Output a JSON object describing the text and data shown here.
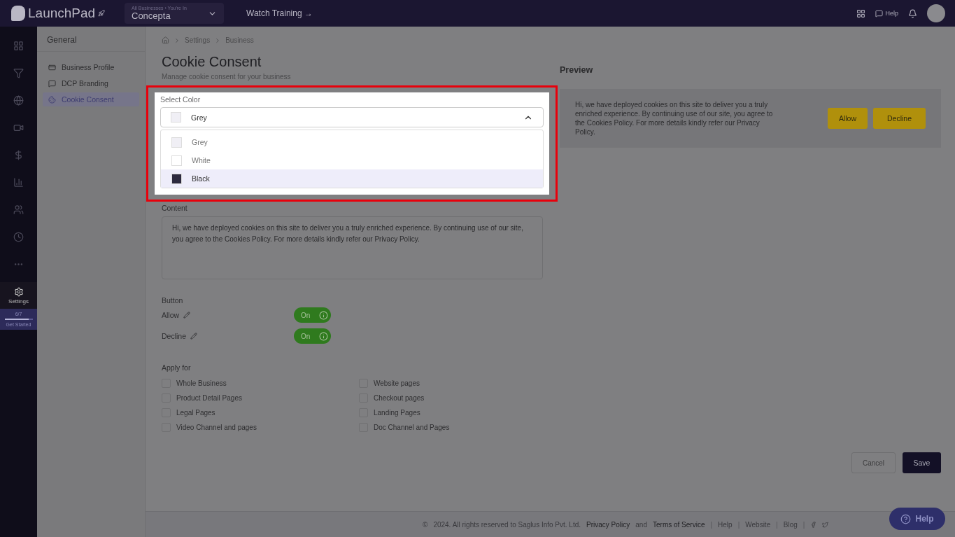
{
  "topbar": {
    "logo": "LaunchPad",
    "business_caption": "All Businesses › You're In",
    "business": "Concepta",
    "training_link": "Watch Training →",
    "help": "Help"
  },
  "rail": {
    "items": [
      {
        "kind": "dashboard",
        "selected": false
      },
      {
        "kind": "filter",
        "selected": false
      },
      {
        "kind": "globe",
        "selected": false
      },
      {
        "kind": "video",
        "selected": false
      },
      {
        "kind": "dollar",
        "selected": false
      },
      {
        "kind": "chart",
        "selected": false
      },
      {
        "kind": "users",
        "selected": false
      },
      {
        "kind": "clock",
        "selected": false
      },
      {
        "kind": "more",
        "selected": false
      }
    ],
    "settings": {
      "label": "Settings",
      "selected": true
    },
    "progress": {
      "count": "6/7",
      "level": 0.85,
      "label": "Get Started"
    }
  },
  "sidebar": {
    "heading": "General",
    "items": [
      {
        "label": "Business Profile",
        "selected": false
      },
      {
        "label": "DCP Branding",
        "selected": false
      },
      {
        "label": "Cookie Consent",
        "selected": true
      }
    ]
  },
  "breadcrumb": [
    "Settings",
    "Business"
  ],
  "page": {
    "title": "Cookie Consent",
    "subtitle": "Manage cookie consent for your business"
  },
  "color_picker": {
    "label": "Select Color",
    "value": {
      "label": "Grey",
      "color": "#f0eff5"
    },
    "expanded": true,
    "options": [
      {
        "label": "Grey",
        "color": "#f0eff5",
        "hovered": false
      },
      {
        "label": "White",
        "color": "#ffffff",
        "hovered": false
      },
      {
        "label": "Black",
        "color": "#2d2a3e",
        "hovered": true
      }
    ]
  },
  "content": {
    "label": "Content",
    "text": "Hi, we have deployed cookies on this site to deliver you a truly enriched experience. By continuing use of our site, you agree to the Cookies Policy. For more details kindly refer our Privacy Policy."
  },
  "buttons_section": {
    "heading": "Button",
    "items": [
      {
        "label": "Allow",
        "toggle": "On",
        "on": true
      },
      {
        "label": "Decline",
        "toggle": "On",
        "on": true
      }
    ]
  },
  "apply_for": {
    "heading": "Apply for",
    "options": [
      {
        "label": "Whole Business",
        "checked": false
      },
      {
        "label": "Website pages",
        "checked": false
      },
      {
        "label": "Product Detail Pages",
        "checked": false
      },
      {
        "label": "Checkout pages",
        "checked": false
      },
      {
        "label": "Legal Pages",
        "checked": false
      },
      {
        "label": "Landing Pages",
        "checked": false
      },
      {
        "label": "Video Channel and pages",
        "checked": false
      },
      {
        "label": "Doc Channel and Pages",
        "checked": false
      }
    ]
  },
  "preview": {
    "heading": "Preview",
    "text": "Hi, we have deployed cookies on this site to deliver you a truly enriched experience. By continuing use of our site, you agree to the Cookies Policy. For more details kindly refer our Privacy Policy.",
    "allow": "Allow",
    "decline": "Decline"
  },
  "actions": {
    "cancel": "Cancel",
    "save": "Save"
  },
  "footer": {
    "copyright_mark": "©",
    "separator": "|",
    "copyright": "2024. All rights reserved to Saglus Info Pvt. Ltd.",
    "privacy": "Privacy Policy",
    "and": "and",
    "terms": "Terms of Service",
    "links": [
      "Help",
      "Website",
      "Blog"
    ]
  },
  "help_button": "Help"
}
